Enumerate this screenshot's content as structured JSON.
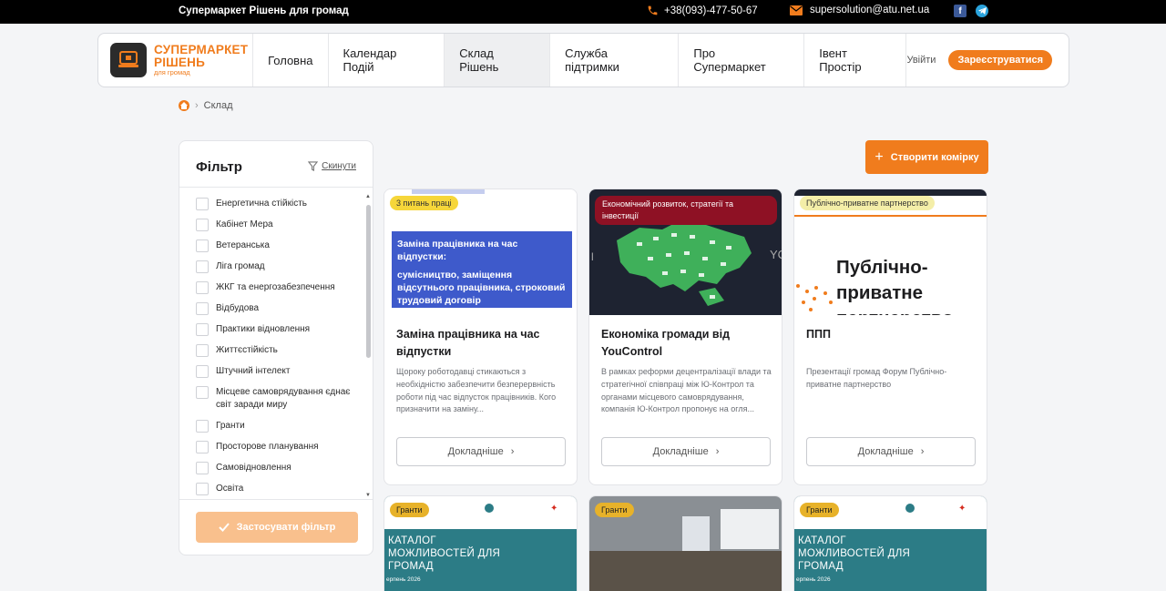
{
  "topbar": {
    "brand": "Супермаркет Рішень для громад",
    "phone": "+38(093)-477-50-67",
    "email": "supersolution@atu.net.ua",
    "icons": [
      "phone-icon",
      "mail-icon",
      "facebook-icon",
      "telegram-icon"
    ]
  },
  "logo": {
    "line1": "СУПЕРМАРКЕТ",
    "line2": "РІШЕНЬ",
    "line3": "для громад"
  },
  "nav": [
    {
      "label": "Головна"
    },
    {
      "label": "Календар Подій"
    },
    {
      "label": "Склад Рішень",
      "active": true
    },
    {
      "label": "Служба підтримки"
    },
    {
      "label": "Про Супермаркет"
    },
    {
      "label": "Івент Простір"
    }
  ],
  "auth": {
    "login": "Увійти",
    "register": "Зареєструватися"
  },
  "breadcrumb": {
    "current": "Склад"
  },
  "filter": {
    "title": "Фільтр",
    "reset": "Скинути",
    "apply": "Застосувати фільтр",
    "items": [
      "Енергетична стійкість",
      "Кабінет Мера",
      "Ветеранська",
      "Ліга громад",
      "ЖКГ та енергозабезпечення",
      "Відбудова",
      "Практики відновлення",
      "Життєстійкість",
      "Штучний інтелект",
      "Місцеве самоврядування єднає світ заради миру",
      "Гранти",
      "Просторове планування",
      "Самовідновлення",
      "Освіта"
    ]
  },
  "create_button": "Створити комірку",
  "cards": [
    {
      "tag": "3 питань праці",
      "image_text_1": "Заміна працівника на час відпустки:",
      "image_text_2": "сумісництво, заміщення відсутнього працівника, строковий трудовий договір",
      "title": "Заміна працівника на час відпустки",
      "desc": "Щороку роботодавці стикаються з необхідністю забезпечити безперервність роботи під час відпусток працівників. Кого призначити на заміну...",
      "more": "Докладніше"
    },
    {
      "tag": "Економічний розвиток, стратегії та інвестиції",
      "title": "Економіка громади від YouControl",
      "desc": "В рамках реформи децентралізації влади та стратегічної співпраці між Ю-Контрол та органами місцевого самоврядування, компанія Ю-Контрол пропонує на огля...",
      "more": "Докладніше"
    },
    {
      "tag": "Публічно-приватне партнерство",
      "image_text": "Публічно-приватне партнерство",
      "title": "ППП",
      "desc": "Презентації громад Форум Публічно-приватне партнерство",
      "more": "Докладніше"
    }
  ],
  "cards_row2": [
    {
      "tag": "Гранти",
      "image_text": "КАТАЛОГ МОЖЛИВОСТЕЙ ДЛЯ ГРОМАД",
      "date": "ерпень 2026"
    },
    {
      "tag": "Гранти"
    },
    {
      "tag": "Гранти",
      "image_text": "КАТАЛОГ МОЖЛИВОСТЕЙ ДЛЯ ГРОМАД",
      "date": "ерпень 2026"
    }
  ],
  "colors": {
    "accent": "#f07c1d",
    "apply_disabled": "#f9c08d",
    "topbar": "#000000"
  }
}
